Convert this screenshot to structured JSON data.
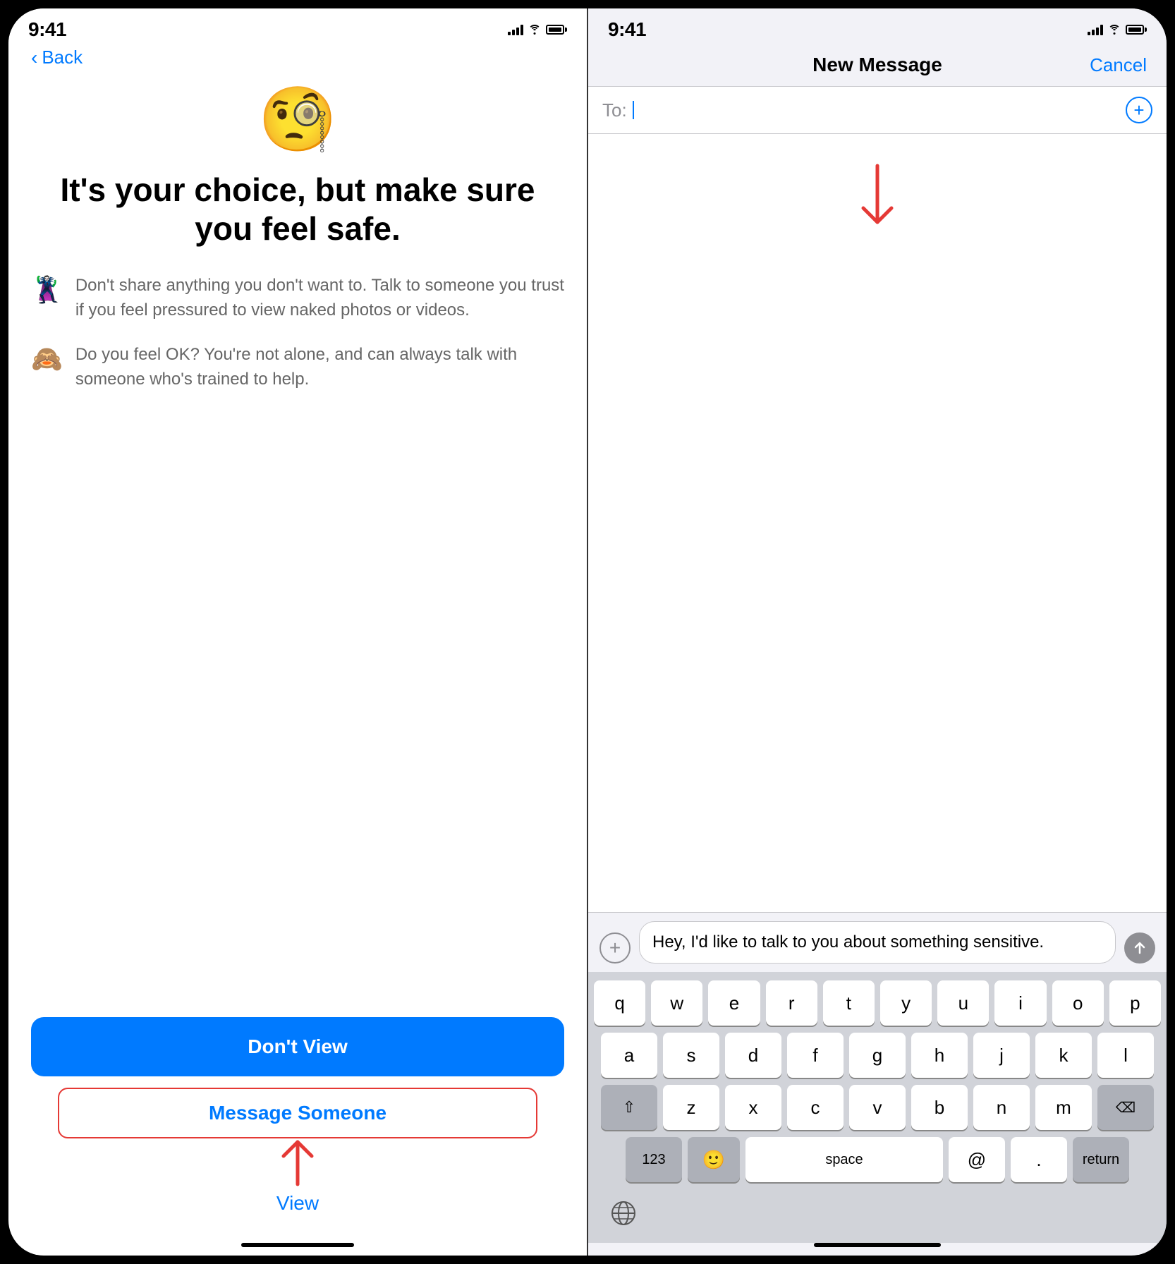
{
  "left_phone": {
    "status_time": "9:41",
    "back_label": "Back",
    "emoji": "🧐",
    "heading": "It's your choice, but make sure you feel safe.",
    "tips": [
      {
        "emoji": "🦹",
        "text": "Don't share anything you don't want to. Talk to someone you trust if you feel pressured to view naked photos or videos."
      },
      {
        "emoji": "🙈",
        "text": "Do you feel OK? You're not alone, and can always talk with someone who's trained to help."
      }
    ],
    "dont_view_label": "Don't View",
    "message_someone_label": "Message Someone",
    "view_label": "View"
  },
  "right_phone": {
    "status_time": "9:41",
    "header_title": "New Message",
    "cancel_label": "Cancel",
    "to_label": "To:",
    "message_text": "Hey, I'd like to talk to you about something sensitive.",
    "keyboard": {
      "rows": [
        [
          "q",
          "w",
          "e",
          "r",
          "t",
          "y",
          "u",
          "i",
          "o",
          "p"
        ],
        [
          "a",
          "s",
          "d",
          "f",
          "g",
          "h",
          "j",
          "k",
          "l"
        ],
        [
          "z",
          "x",
          "c",
          "v",
          "b",
          "n",
          "m"
        ],
        [
          "123",
          "space",
          "@",
          ".",
          "return"
        ]
      ]
    }
  }
}
